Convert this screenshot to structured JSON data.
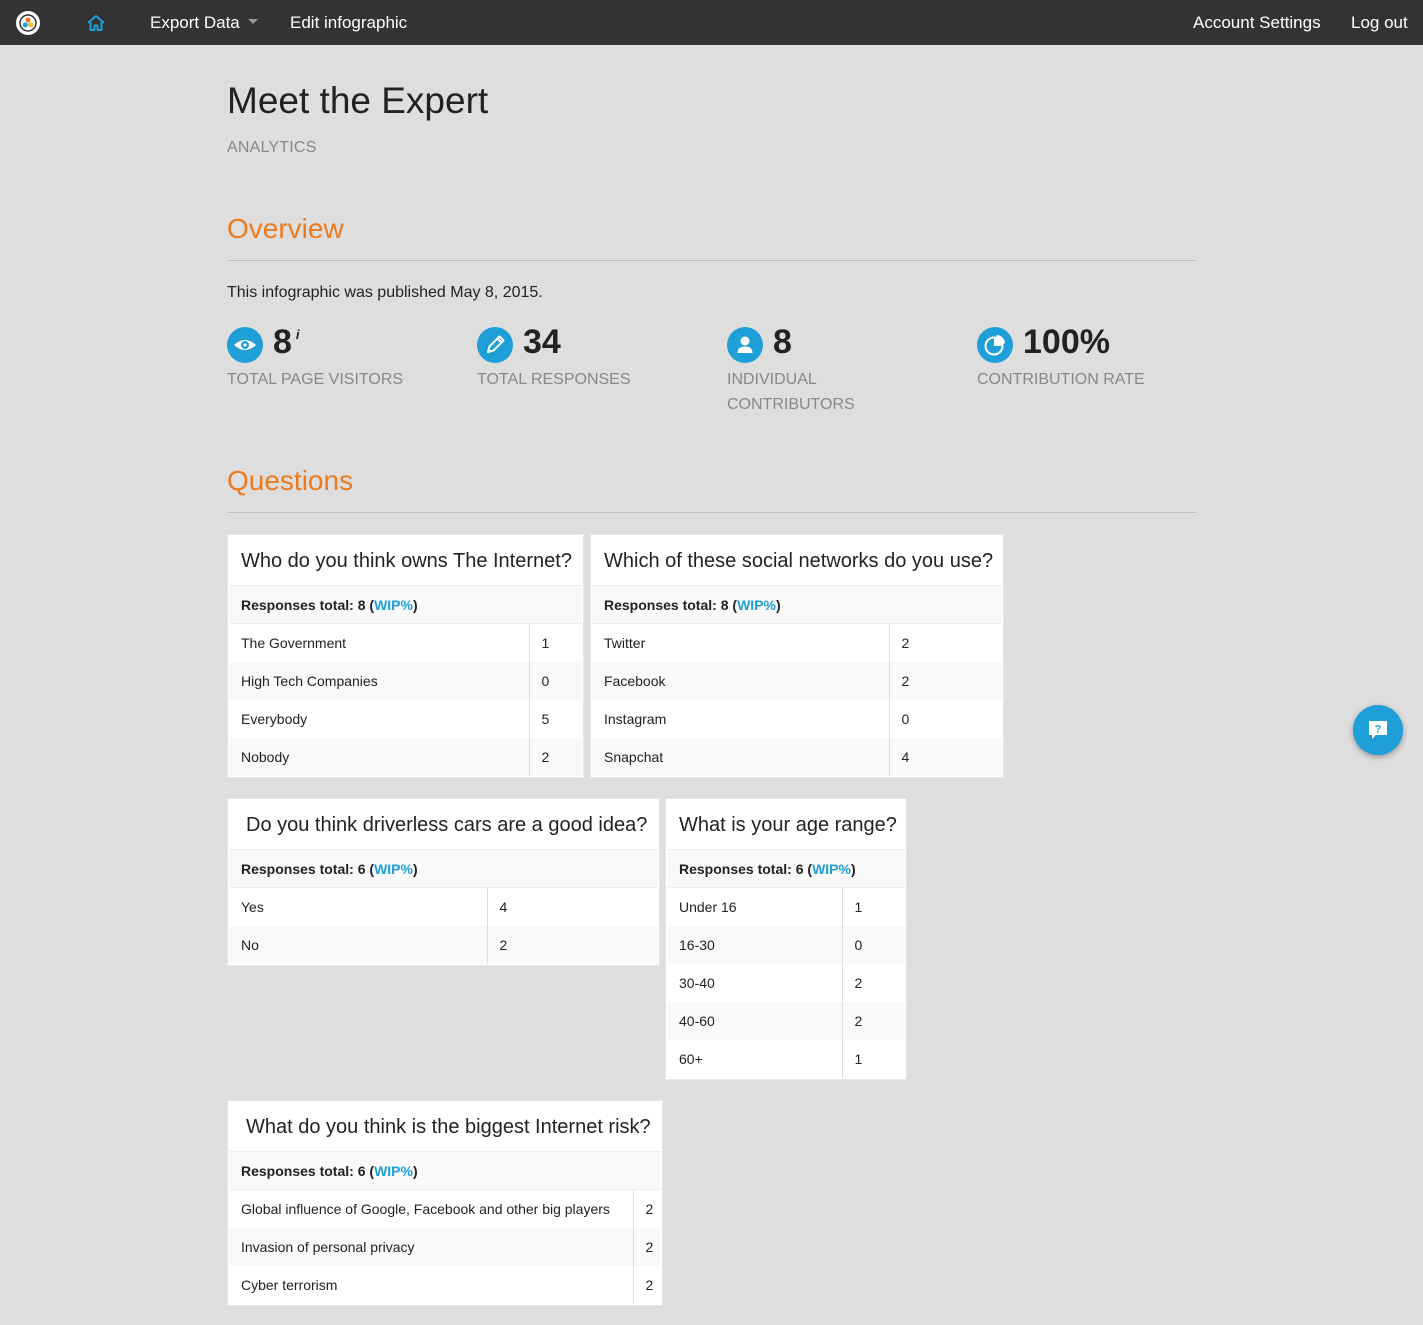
{
  "nav": {
    "export_label": "Export Data",
    "edit_label": "Edit infographic",
    "account_label": "Account Settings",
    "logout_label": "Log out"
  },
  "header": {
    "title": "Meet the Expert",
    "subtitle": "ANALYTICS"
  },
  "overview": {
    "title": "Overview",
    "published": "This infographic was published May 8, 2015.",
    "stats": [
      {
        "value": "8",
        "label": "TOTAL PAGE VISITORS",
        "icon": "eye-icon",
        "info": "i"
      },
      {
        "value": "34",
        "label": "TOTAL RESPONSES",
        "icon": "pencil-icon"
      },
      {
        "value": "8",
        "label": "INDIVIDUAL CONTRIBUTORS",
        "icon": "user-icon"
      },
      {
        "value": "100%",
        "label": "CONTRIBUTION RATE",
        "icon": "pie-chart-icon"
      }
    ]
  },
  "questions": {
    "title": "Questions",
    "items": [
      {
        "title": "Who do you think owns The Internet?",
        "total_prefix": "Responses total: ",
        "total": "8",
        "wip": "WIP%",
        "rows": [
          {
            "answer": "The Government",
            "count": "1"
          },
          {
            "answer": "High Tech Companies",
            "count": "0"
          },
          {
            "answer": "Everybody",
            "count": "5"
          },
          {
            "answer": "Nobody",
            "count": "2"
          }
        ]
      },
      {
        "title": "Which of these social networks do you use?",
        "total_prefix": "Responses total: ",
        "total": "8",
        "wip": "WIP%",
        "rows": [
          {
            "answer": "Twitter",
            "count": "2"
          },
          {
            "answer": "Facebook",
            "count": "2"
          },
          {
            "answer": "Instagram",
            "count": "0"
          },
          {
            "answer": "Snapchat",
            "count": "4"
          }
        ]
      },
      {
        "title": "Do you think driverless cars are a good idea?",
        "total_prefix": "Responses total: ",
        "total": "6",
        "wip": "WIP%",
        "rows": [
          {
            "answer": "Yes",
            "count": "4"
          },
          {
            "answer": "No",
            "count": "2"
          }
        ]
      },
      {
        "title": "What is your age range?",
        "total_prefix": "Responses total: ",
        "total": "6",
        "wip": "WIP%",
        "rows": [
          {
            "answer": "Under 16",
            "count": "1"
          },
          {
            "answer": "16-30",
            "count": "0"
          },
          {
            "answer": "30-40",
            "count": "2"
          },
          {
            "answer": "40-60",
            "count": "2"
          },
          {
            "answer": "60+",
            "count": "1"
          }
        ]
      },
      {
        "title": "What do you think is the biggest Internet risk?",
        "total_prefix": "Responses total: ",
        "total": "6",
        "wip": "WIP%",
        "rows": [
          {
            "answer": "Global influence of Google, Facebook and other big players",
            "count": "2"
          },
          {
            "answer": "Invasion of personal privacy",
            "count": "2"
          },
          {
            "answer": "Cyber terrorism",
            "count": "2"
          }
        ]
      }
    ]
  },
  "colors": {
    "accent": "#ec7a1f",
    "brand_blue": "#1e9fd8",
    "nav_bg": "#333333",
    "page_bg": "#dedede"
  }
}
